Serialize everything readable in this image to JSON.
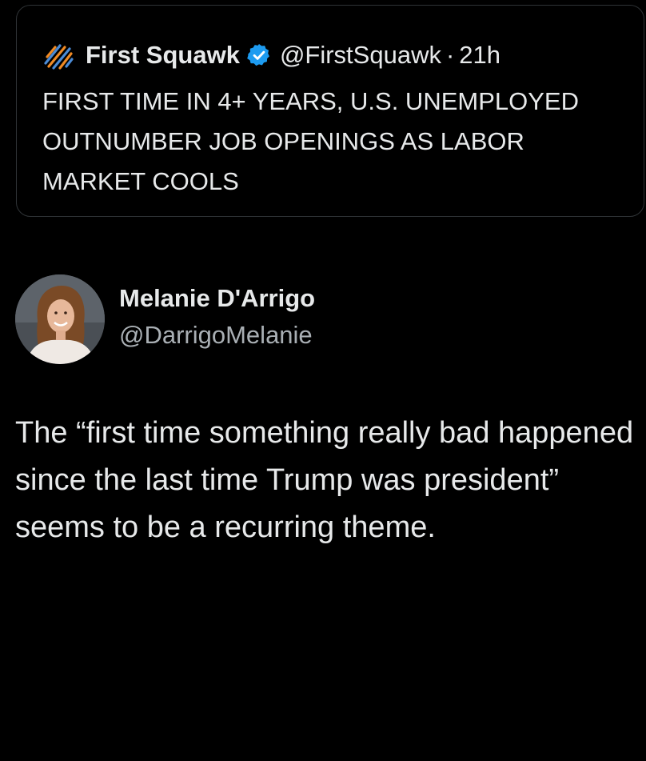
{
  "quoted_tweet": {
    "display_name": "First Squawk",
    "handle": "@FirstSquawk",
    "separator": "·",
    "time": "21h",
    "logo_icon": "first-squawk-logo-icon",
    "verified_icon": "verified-badge-icon",
    "text": "FIRST TIME IN 4+ YEARS, U.S. UNEMPLOYED OUTNUMBER JOB OPENINGS AS LABOR MARKET COOLS"
  },
  "author": {
    "display_name": "Melanie D'Arrigo",
    "handle": "@DarrigoMelanie",
    "avatar_icon": "avatar-photo"
  },
  "tweet": {
    "text": "The “first time something really bad happened since the last time Trump was president” seems to be a recurring theme."
  },
  "colors": {
    "background": "#000000",
    "text_primary": "#e7e9ea",
    "text_secondary": "#a9afb4",
    "border": "#2f3336",
    "verified_blue": "#1d9bf0",
    "logo_orange": "#f08a24",
    "logo_blue": "#4b8bd6"
  }
}
